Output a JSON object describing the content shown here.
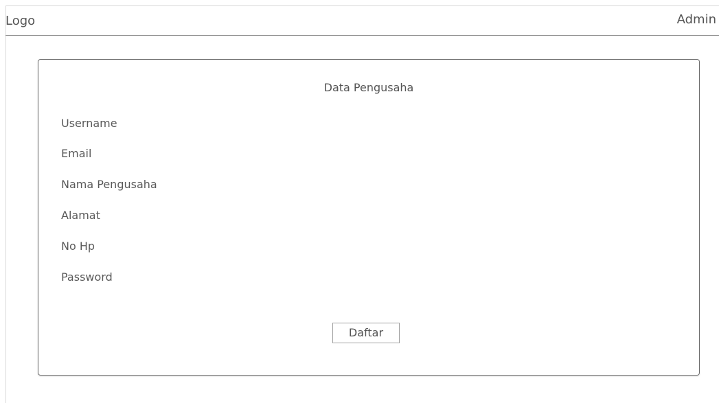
{
  "header": {
    "logo": "Logo",
    "user": "Admin"
  },
  "form": {
    "title": "Data Pengusaha",
    "fields": [
      {
        "label": "Username"
      },
      {
        "label": "Email"
      },
      {
        "label": "Nama Pengusaha"
      },
      {
        "label": "Alamat"
      },
      {
        "label": "No Hp"
      },
      {
        "label": "Password"
      }
    ],
    "submit_label": "Daftar"
  }
}
